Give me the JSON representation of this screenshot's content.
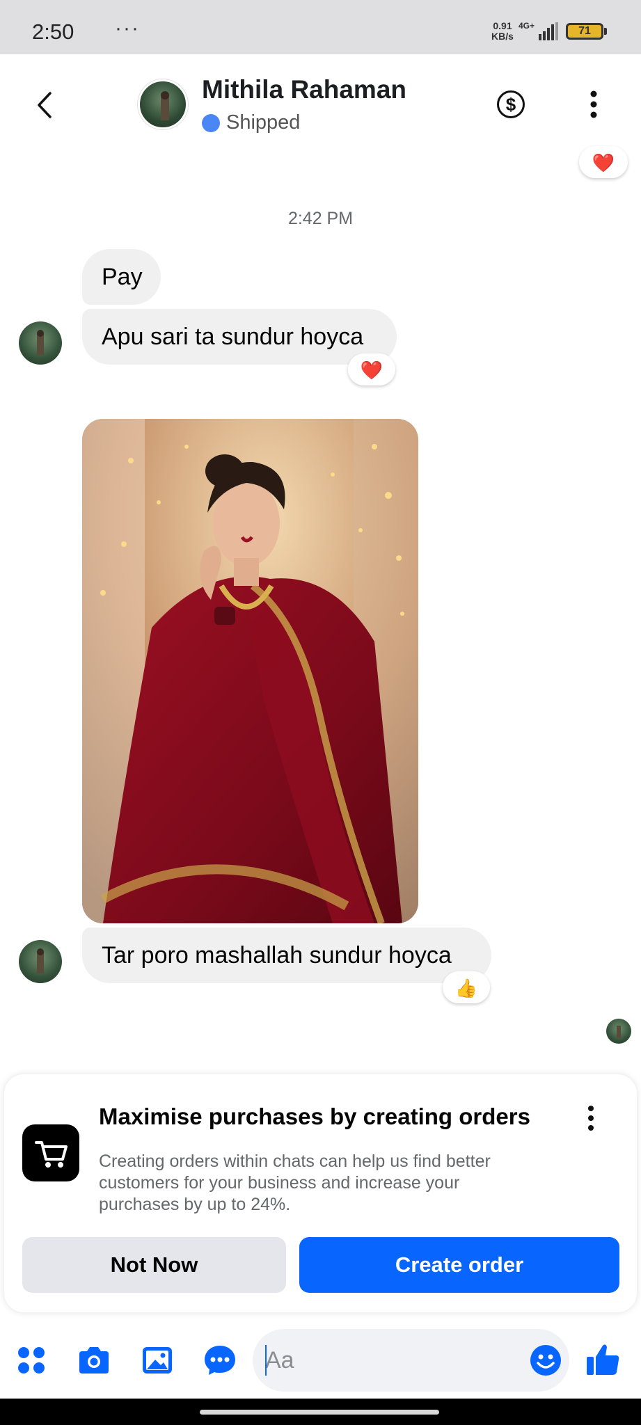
{
  "status_bar": {
    "time": "2:50",
    "notif_label": "",
    "dots": "···",
    "speed": "0.91 KB/s",
    "network": "4G+",
    "battery": "71"
  },
  "header": {
    "contact_name": "Mithila Rahaman",
    "status": "Shipped",
    "status_color": "#4a86f5"
  },
  "chat": {
    "timestamp": "2:42 PM",
    "messages": [
      {
        "text": "Pay"
      },
      {
        "text": "Apu sari ta sundur hoyca",
        "reaction": "❤️"
      },
      {
        "image": "Saree photo"
      },
      {
        "text": "Tar poro mashallah sundur hoyca",
        "reaction": "👍"
      }
    ],
    "top_reaction": "❤️"
  },
  "promo": {
    "title": "Maximise purchases by creating orders",
    "description": "Creating orders within chats can help us find better customers for your business and increase your purchases by up to 24%.",
    "not_now_label": "Not Now",
    "create_label": "Create order"
  },
  "composer": {
    "placeholder": "Aa"
  },
  "colors": {
    "accent": "#0866ff",
    "bubble": "#f0f0f0"
  },
  "icons": [
    "back-icon",
    "dollar-icon",
    "more-icon",
    "apps-icon",
    "camera-icon",
    "gallery-icon",
    "chat-bubble-icon",
    "emoji-icon",
    "thumbs-up-icon",
    "cart-icon"
  ]
}
